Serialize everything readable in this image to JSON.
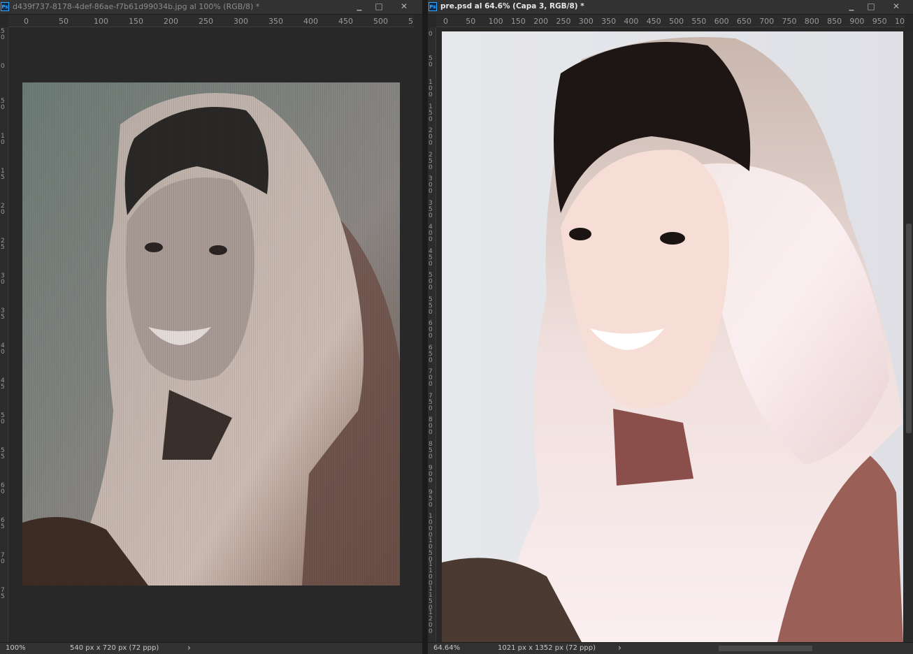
{
  "left_window": {
    "app_badge": "Ps",
    "title": "d439f737-8178-4def-86ae-f7b61d99034b.jpg al 100% (RGB/8) *",
    "ruler_labels": [
      "0",
      "50",
      "100",
      "150",
      "200",
      "250",
      "300",
      "350",
      "400",
      "450",
      "500",
      "5"
    ],
    "vruler_labels": [
      "5\n0",
      "0",
      "5\n0",
      "1\n0",
      "1\n5",
      "2\n0",
      "2\n5",
      "3\n0",
      "3\n5",
      "4\n0",
      "4\n5",
      "5\n0",
      "5\n5",
      "6\n0",
      "6\n5",
      "7\n0",
      "7\n5"
    ],
    "zoom": "100%",
    "doc_info": "540 px x 720 px (72 ppp)",
    "status_arrow": "›"
  },
  "right_window": {
    "app_badge": "Ps",
    "title": "pre.psd al 64.6% (Capa 3, RGB/8) *",
    "ruler_labels": [
      "0",
      "50",
      "100",
      "150",
      "200",
      "250",
      "300",
      "350",
      "400",
      "450",
      "500",
      "550",
      "600",
      "650",
      "700",
      "750",
      "800",
      "850",
      "900",
      "950",
      "10"
    ],
    "vruler_labels": [
      "0",
      "5\n0",
      "1\n0\n0",
      "1\n5\n0",
      "2\n0\n0",
      "2\n5\n0",
      "3\n0\n0",
      "3\n5\n0",
      "4\n0\n0",
      "4\n5\n0",
      "5\n0\n0",
      "5\n5\n0",
      "6\n0\n0",
      "6\n5\n0",
      "7\n0\n0",
      "7\n5\n0",
      "8\n0\n0",
      "8\n5\n0",
      "9\n0\n0",
      "9\n5\n0",
      "1\n0\n0\n0",
      "1\n0\n5\n0",
      "1\n1\n0\n0",
      "1\n1\n5\n0",
      "1\n2\n0\n0"
    ],
    "zoom": "64.64%",
    "doc_info": "1021 px x 1352 px (72 ppp)",
    "status_arrow": "›"
  },
  "window_controls": {
    "minimize": "▁",
    "maximize": "□",
    "close": "✕"
  }
}
